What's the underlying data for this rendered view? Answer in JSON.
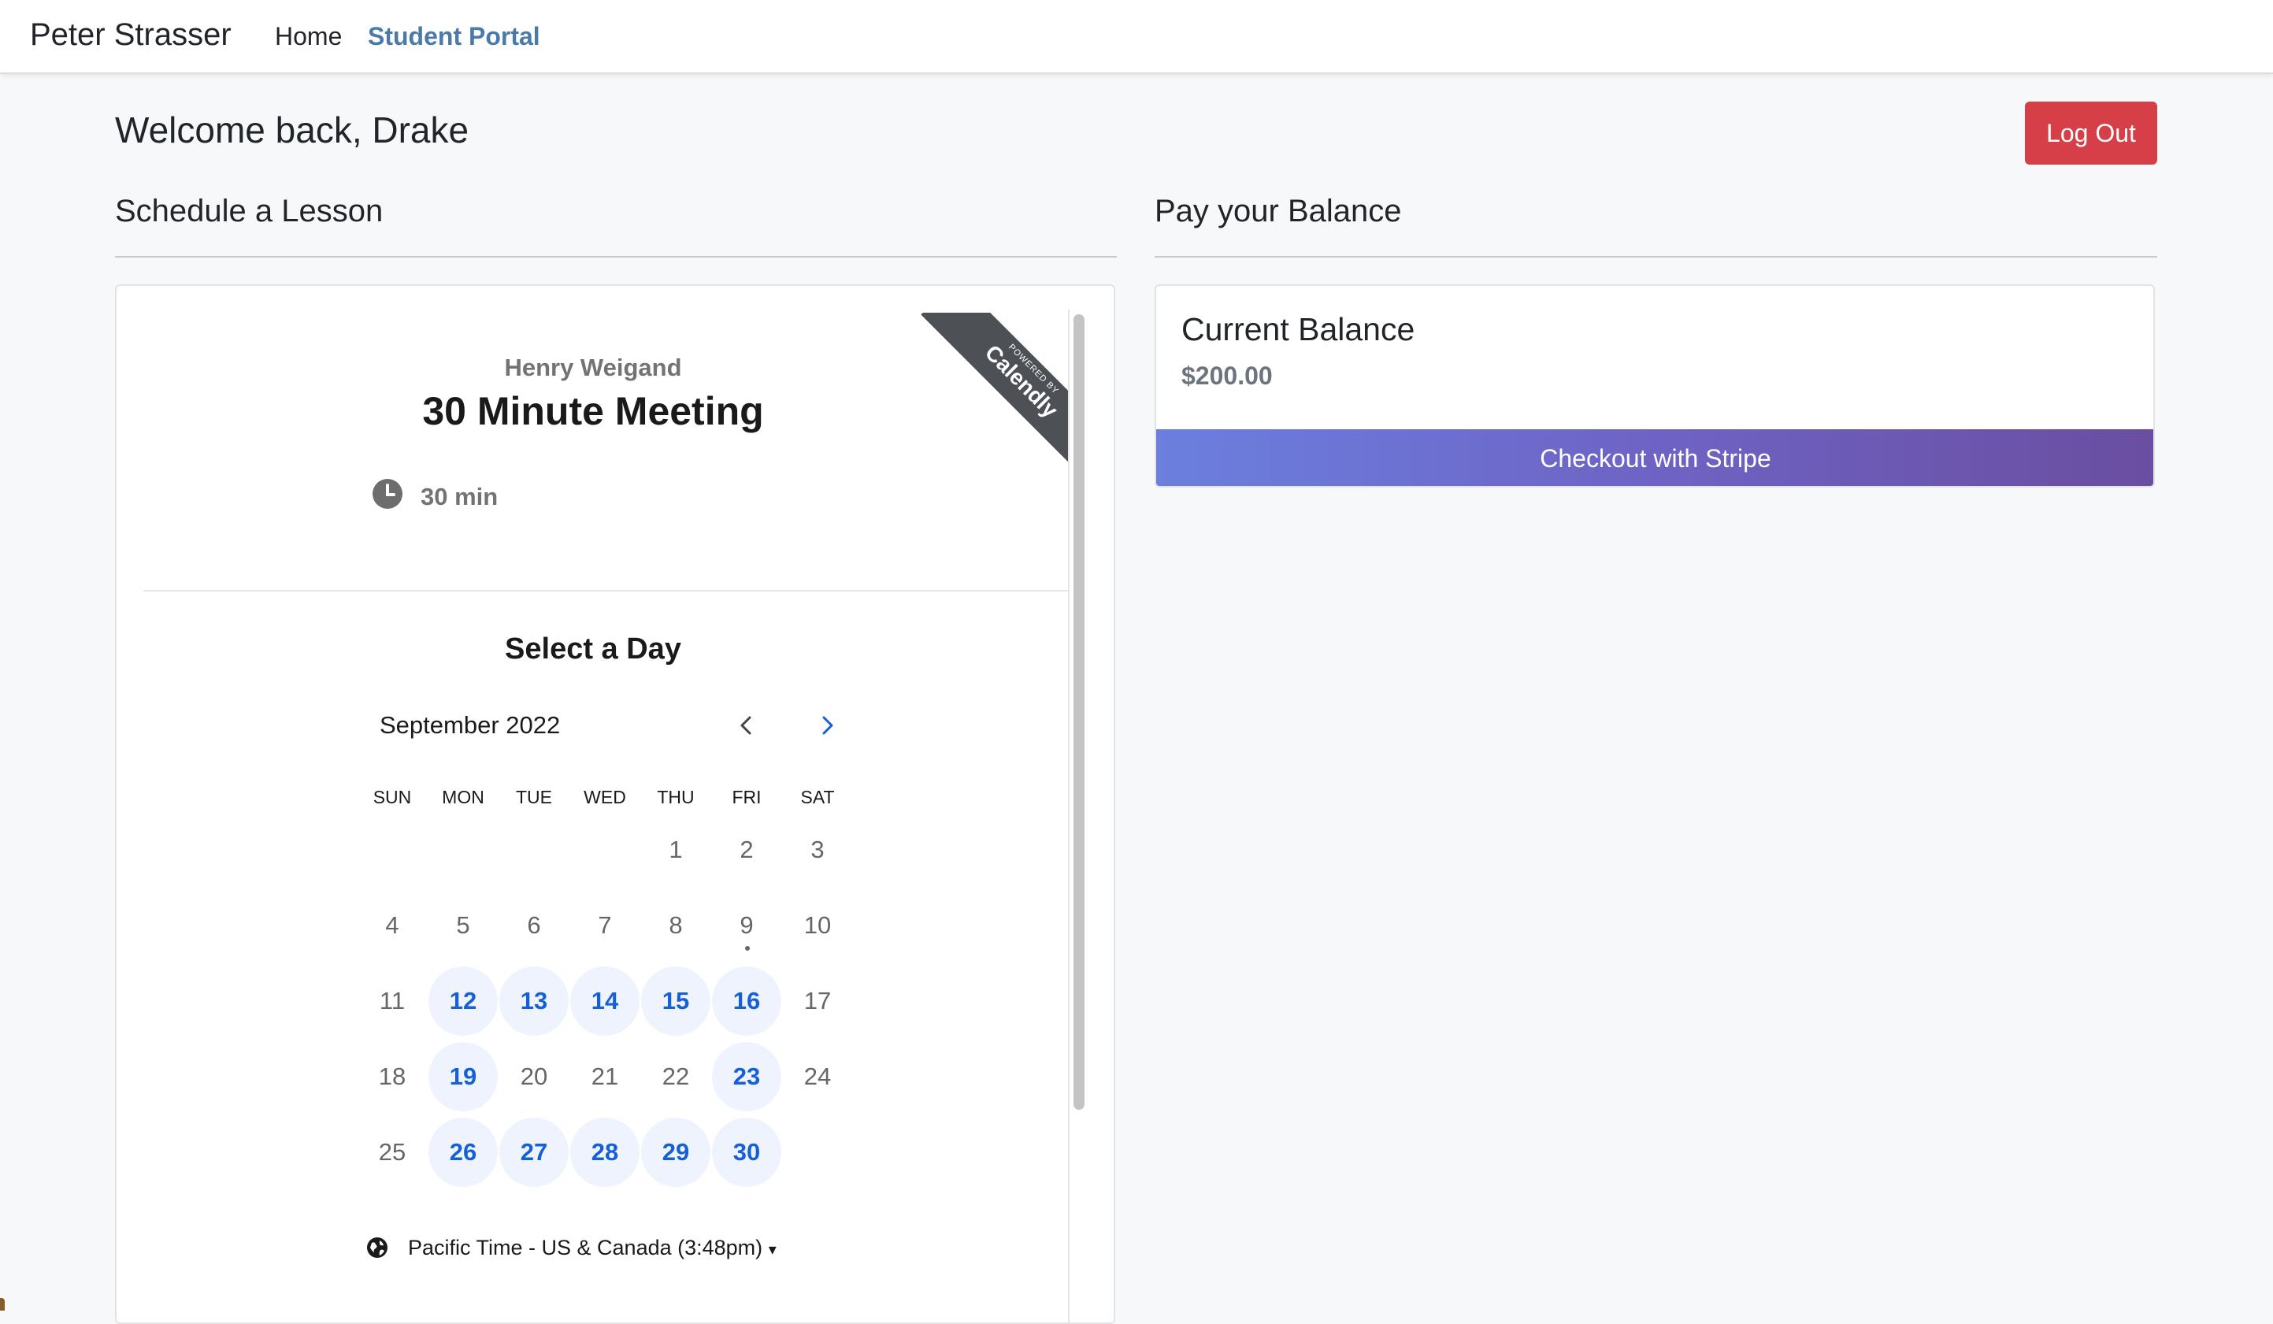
{
  "nav": {
    "brand": "Peter Strasser",
    "links": [
      {
        "label": "Home"
      },
      {
        "label": "Student Portal"
      }
    ]
  },
  "header": {
    "welcome": "Welcome back, Drake",
    "logout_label": "Log Out"
  },
  "schedule": {
    "title": "Schedule a Lesson",
    "calendly": {
      "ribbon_powered": "POWERED BY",
      "ribbon_brand": "Calendly",
      "host": "Henry Weigand",
      "meeting_name": "30 Minute Meeting",
      "duration": "30 min",
      "select_day": "Select a Day",
      "month": "September 2022",
      "weekdays": [
        "SUN",
        "MON",
        "TUE",
        "WED",
        "THU",
        "FRI",
        "SAT"
      ],
      "weeks": [
        [
          null,
          null,
          null,
          null,
          "1",
          "2",
          "3"
        ],
        [
          "4",
          "5",
          "6",
          "7",
          "8",
          "9",
          "10"
        ],
        [
          "11",
          "12",
          "13",
          "14",
          "15",
          "16",
          "17"
        ],
        [
          "18",
          "19",
          "20",
          "21",
          "22",
          "23",
          "24"
        ],
        [
          "25",
          "26",
          "27",
          "28",
          "29",
          "30",
          null
        ]
      ],
      "available_days": [
        "12",
        "13",
        "14",
        "15",
        "16",
        "19",
        "23",
        "26",
        "27",
        "28",
        "29",
        "30"
      ],
      "today": "9",
      "timezone": "Pacific Time - US & Canada (3:48pm)",
      "accent_color": "#1560d4",
      "available_bg": "#eef3fd"
    }
  },
  "balance": {
    "title": "Pay your Balance",
    "card_title": "Current Balance",
    "amount": "$200.00",
    "checkout_label": "Checkout with Stripe"
  }
}
